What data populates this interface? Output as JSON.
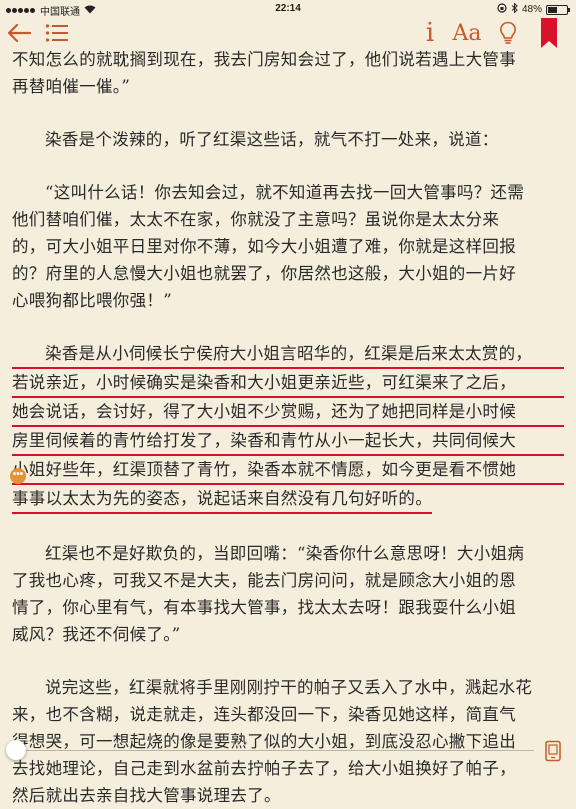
{
  "status_bar": {
    "carrier": "中国联通",
    "time": "22:14",
    "battery_percent": "48%",
    "battery_level": 0.48
  },
  "toolbar": {
    "info_label": "i",
    "font_label": "Aa",
    "accent_color": "#c8592b"
  },
  "content": {
    "p1": [
      "不知怎么的就耽搁到现在，我去门房知会过了，他们说若遇上大管事",
      "再替咱催一催。”"
    ],
    "p2": [
      "染香是个泼辣的，听了红渠这些话，就气不打一处来，说道："
    ],
    "p3": [
      "“这叫什么话！你去知会过，就不知道再去找一回大管事吗？还需",
      "他们替咱们催，太太不在家，你就没了主意吗？虽说你是太太分来",
      "的，可大小姐平日里对你不薄，如今大小姐遭了难，你就是这样回报",
      "的？府里的人怠慢大小姐也就罢了，你居然也这般，大小姐的一片好",
      "心喂狗都比喂你强！”"
    ],
    "p4_highlighted": [
      "染香是从小伺候长宁侯府大小姐言昭华的，红渠是后来太太赏的，",
      "若说亲近，小时候确实是染香和大小姐更亲近些，可红渠来了之后，",
      "她会说话，会讨好，得了大小姐不少赏赐，还为了她把同样是小时候",
      "房里伺候着的青竹给打发了，染香和青竹从小一起长大，共同伺候大",
      "小姐好些年，红渠顶替了青竹，染香本就不情愿，如今更是看不惯她",
      "事事以太太为先的姿态，说起话来自然没有几句好听的。"
    ],
    "p5": [
      "红渠也不是好欺负的，当即回嘴：“染香你什么意思呀！大小姐病",
      "了我也心疼，可我又不是大夫，能去门房问问，就是顾念大小姐的恩",
      "情了，你心里有气，有本事找大管事，找太太去呀！跟我耍什么小姐",
      "威风？我还不伺候了。”"
    ],
    "p6": [
      "说完这些，红渠就将手里刚刚拧干的帕子又丢入了水中，溅起水花",
      "来，也不含糊，说走就走，连头都没回一下，染香见她这样，简直气",
      "得想哭，可一想起烧的像是要熟了似的大小姐，到底没忍心撇下追出",
      "去找她理论，自己走到水盆前去拧帕子去了，给大小姐换好了帕子，",
      "然后就出去亲自找大管事说理去了。"
    ],
    "note_label": "•••",
    "highlight_color": "#d8122d"
  },
  "progress": {
    "reading_fraction": 0.0
  }
}
